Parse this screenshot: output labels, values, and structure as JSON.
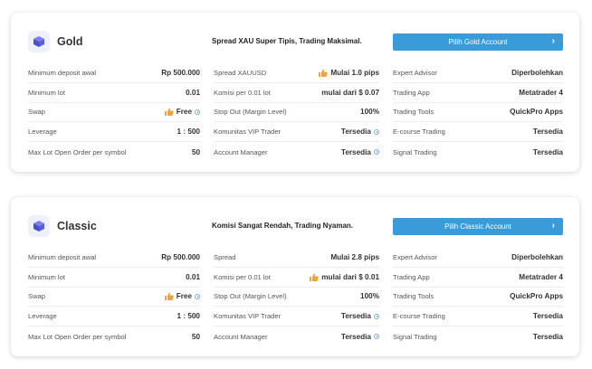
{
  "colors": {
    "accent": "#3a9bd9",
    "thumb": "#f0a23b",
    "logo": "#5b5fd6"
  },
  "cards": [
    {
      "title": "Gold",
      "tagline": "Spread XAU Super Tipis, Trading Maksimal.",
      "cta": "Pilih Gold Account",
      "col1": [
        {
          "label": "Minimum deposit awal",
          "value": "Rp 500.000"
        },
        {
          "label": "Minimum lot",
          "value": "0.01"
        },
        {
          "label": "Swap",
          "value": "Free"
        },
        {
          "label": "Leverage",
          "value": "1 : 500"
        },
        {
          "label": "Max Lot Open Order per symbol",
          "value": "50"
        }
      ],
      "col2": [
        {
          "label": "Spread XAUUSD",
          "value": "Mulai 1.0 pips"
        },
        {
          "label": "Komisi per 0.01 lot",
          "value": "mulai dari $ 0.07"
        },
        {
          "label": "Stop Out (Margin Level)",
          "value": "100%"
        },
        {
          "label": "Komunitas VIP Trader",
          "value": "Tersedia"
        },
        {
          "label": "Account Manager",
          "value": "Tersedia"
        }
      ],
      "col3": [
        {
          "label": "Expert Advisor",
          "value": "Diperbolehkan"
        },
        {
          "label": "Trading App",
          "value": "Metatrader 4"
        },
        {
          "label": "Trading Tools",
          "value": "QuickPro Apps"
        },
        {
          "label": "E-course Trading",
          "value": "Tersedia"
        },
        {
          "label": "Signal Trading",
          "value": "Tersedia"
        }
      ]
    },
    {
      "title": "Classic",
      "tagline": "Komisi Sangat Rendah, Trading Nyaman.",
      "cta": "Pilih Classic Account",
      "col1": [
        {
          "label": "Minimum deposit awal",
          "value": "Rp 500.000"
        },
        {
          "label": "Minimum lot",
          "value": "0.01"
        },
        {
          "label": "Swap",
          "value": "Free"
        },
        {
          "label": "Leverage",
          "value": "1 : 500"
        },
        {
          "label": "Max Lot Open Order per symbol",
          "value": "50"
        }
      ],
      "col2": [
        {
          "label": "Spread",
          "value": "Mulai 2.8 pips"
        },
        {
          "label": "Komisi per 0.01 lot",
          "value": "mulai dari $ 0.01"
        },
        {
          "label": "Stop Out (Margin Level)",
          "value": "100%"
        },
        {
          "label": "Komunitas VIP Trader",
          "value": "Tersedia"
        },
        {
          "label": "Account Manager",
          "value": "Tersedia"
        }
      ],
      "col3": [
        {
          "label": "Expert Advisor",
          "value": "Diperbolehkan"
        },
        {
          "label": "Trading App",
          "value": "Metatrader 4"
        },
        {
          "label": "Trading Tools",
          "value": "QuickPro Apps"
        },
        {
          "label": "E-course Trading",
          "value": "Tersedia"
        },
        {
          "label": "Signal Trading",
          "value": "Tersedia"
        }
      ]
    }
  ]
}
